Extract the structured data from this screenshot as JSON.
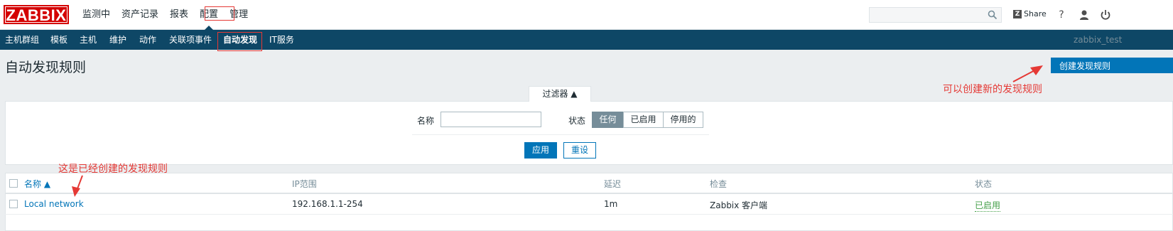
{
  "header": {
    "logo": "ZABBIX",
    "menu": [
      "监测中",
      "资产记录",
      "报表",
      "配置",
      "管理"
    ],
    "selected_menu": "配置",
    "search_placeholder": "",
    "share_label": "Share",
    "help_label": "?"
  },
  "subnav": {
    "items": [
      "主机群组",
      "模板",
      "主机",
      "维护",
      "动作",
      "关联项事件",
      "自动发现",
      "IT服务"
    ],
    "selected": "自动发现",
    "user": "zabbix_test"
  },
  "page": {
    "title": "自动发现规则",
    "create_button": "创建发现规则"
  },
  "filter": {
    "tab_label": "过滤器 ▲",
    "name_label": "名称",
    "name_value": "",
    "status_label": "状态",
    "status_options": [
      "任何",
      "已启用",
      "停用的"
    ],
    "status_selected": "任何",
    "apply_label": "应用",
    "reset_label": "重设"
  },
  "table": {
    "columns": [
      "名称 ▲",
      "IP范围",
      "延迟",
      "检查",
      "状态"
    ],
    "rows": [
      {
        "name": "Local network",
        "ip_range": "192.168.1.1-254",
        "delay": "1m",
        "checks": "Zabbix 客户端",
        "status": "已启用"
      }
    ]
  },
  "annotations": {
    "create_note": "可以创建新的发现规则",
    "existing_note": "这是已经创建的发现规则",
    "color": "#e53935"
  },
  "colors": {
    "logo_red": "#d40000",
    "subnav_bg": "#0e4766",
    "primary_blue": "#0275b8",
    "enabled_green": "#429e47"
  }
}
